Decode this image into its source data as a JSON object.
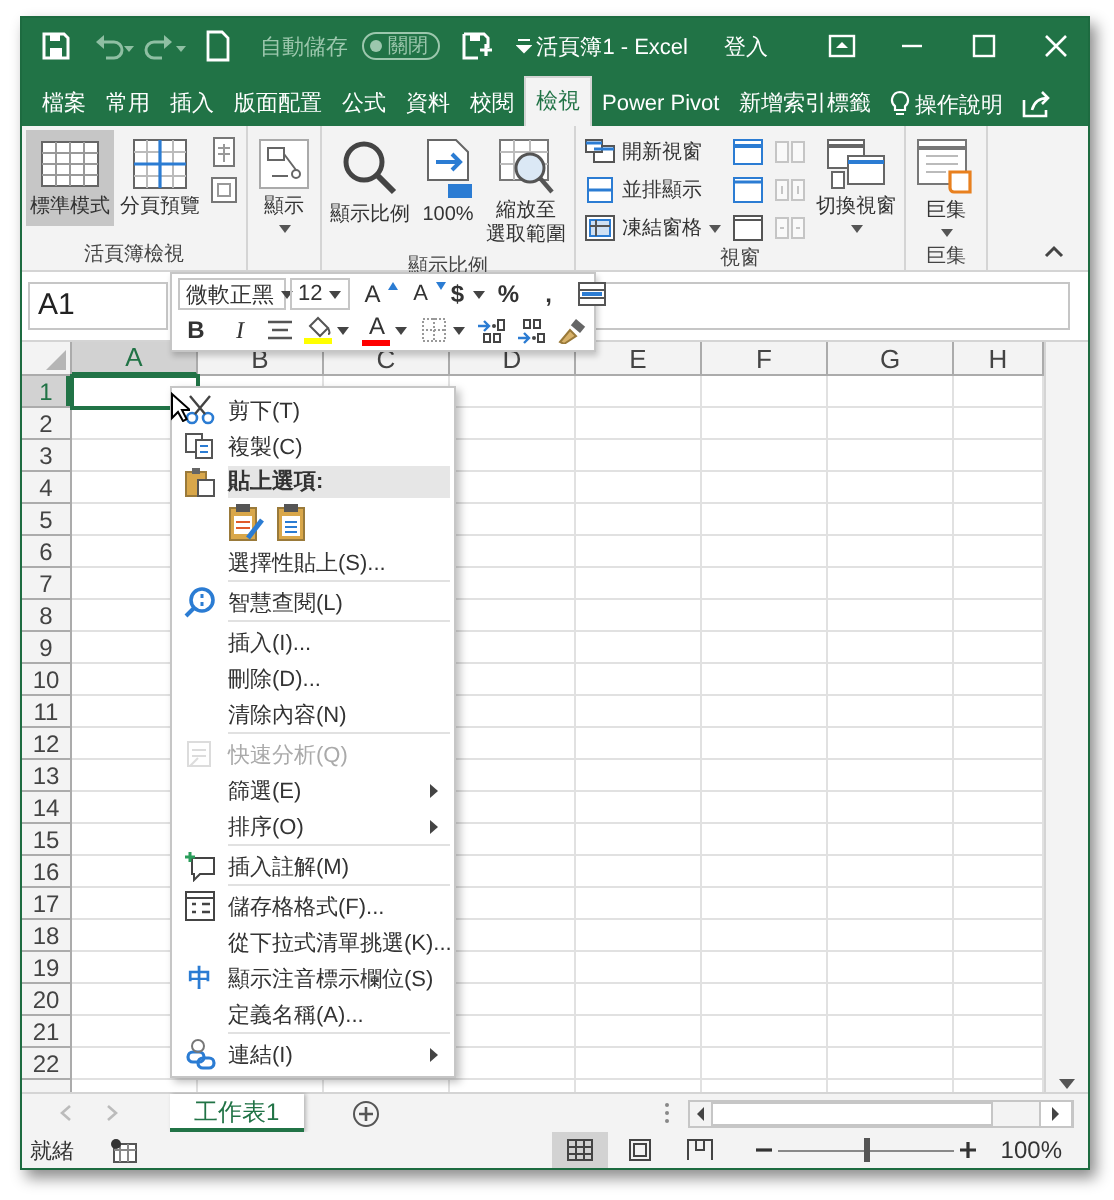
{
  "title_bar": {
    "autosave": {
      "label": "自動儲存",
      "state_text": "關閉",
      "on": false
    },
    "title": "活頁簿1 - Excel",
    "sign_in": "登入"
  },
  "tabs": [
    {
      "label": "檔案",
      "selected": false
    },
    {
      "label": "常用",
      "selected": false
    },
    {
      "label": "插入",
      "selected": false
    },
    {
      "label": "版面配置",
      "selected": false
    },
    {
      "label": "公式",
      "selected": false
    },
    {
      "label": "資料",
      "selected": false
    },
    {
      "label": "校閱",
      "selected": false
    },
    {
      "label": "檢視",
      "selected": true
    },
    {
      "label": "Power Pivot",
      "selected": false
    },
    {
      "label": "新增索引標籤",
      "selected": false
    }
  ],
  "tell_me": "操作說明",
  "ribbon": {
    "groups": [
      {
        "label": "活頁簿檢視",
        "columns": [
          {
            "kind": "large",
            "label": "標準模式",
            "selected": true,
            "dropdown": false
          },
          {
            "kind": "large",
            "label": "分頁預覽",
            "selected": false,
            "dropdown": false
          },
          {
            "kind": "stack",
            "items": [
              {
                "disabled": false
              },
              {
                "disabled": false
              }
            ]
          }
        ]
      },
      {
        "columns": [
          {
            "kind": "large",
            "label": "顯示",
            "selected": false,
            "dropdown": true
          }
        ]
      },
      {
        "label": "顯示比例",
        "columns": [
          {
            "kind": "large",
            "label": "顯示比例",
            "selected": false,
            "dropdown": false
          },
          {
            "kind": "large",
            "label": "100%",
            "selected": false,
            "dropdown": false
          },
          {
            "kind": "large",
            "lines": [
              "縮放至",
              "選取範圍"
            ],
            "selected": false,
            "dropdown": false
          }
        ]
      },
      {
        "label": "視窗",
        "columns": [
          {
            "kind": "stack",
            "items": [
              {
                "label": "開新視窗",
                "dropdown": false,
                "disabled": false
              },
              {
                "label": "並排顯示",
                "dropdown": false,
                "disabled": false
              },
              {
                "label": "凍結窗格",
                "dropdown": true,
                "disabled": false
              }
            ]
          },
          {
            "kind": "stack",
            "items": [
              {
                "disabled": false
              },
              {
                "disabled": false
              },
              {
                "disabled": false
              }
            ]
          },
          {
            "kind": "stack",
            "items": [
              {
                "disabled": true
              },
              {
                "disabled": true
              },
              {
                "disabled": true
              }
            ]
          },
          {
            "kind": "large",
            "label": "切換視窗",
            "selected": false,
            "dropdown": true
          }
        ]
      },
      {
        "label": "巨集",
        "columns": [
          {
            "kind": "large",
            "label": "巨集",
            "selected": false,
            "dropdown": true
          }
        ]
      }
    ]
  },
  "formula_bar": {
    "name_box": "A1"
  },
  "grid": {
    "columns": [
      {
        "label": "A",
        "selected": true
      },
      {
        "label": "B",
        "selected": false
      },
      {
        "label": "C",
        "selected": false
      },
      {
        "label": "D",
        "selected": false
      },
      {
        "label": "E",
        "selected": false
      },
      {
        "label": "F",
        "selected": false
      },
      {
        "label": "G",
        "selected": false
      },
      {
        "label": "H",
        "selected": false
      }
    ],
    "rows": [
      {
        "label": "1",
        "selected": true
      },
      {
        "label": "2",
        "selected": false
      },
      {
        "label": "3",
        "selected": false
      },
      {
        "label": "4",
        "selected": false
      },
      {
        "label": "5",
        "selected": false
      },
      {
        "label": "6",
        "selected": false
      },
      {
        "label": "7",
        "selected": false
      },
      {
        "label": "8",
        "selected": false
      },
      {
        "label": "9",
        "selected": false
      },
      {
        "label": "10",
        "selected": false
      },
      {
        "label": "11",
        "selected": false
      },
      {
        "label": "12",
        "selected": false
      },
      {
        "label": "13",
        "selected": false
      },
      {
        "label": "14",
        "selected": false
      },
      {
        "label": "15",
        "selected": false
      },
      {
        "label": "16",
        "selected": false
      },
      {
        "label": "17",
        "selected": false
      },
      {
        "label": "18",
        "selected": false
      },
      {
        "label": "19",
        "selected": false
      },
      {
        "label": "20",
        "selected": false
      },
      {
        "label": "21",
        "selected": false
      },
      {
        "label": "22",
        "selected": false
      }
    ]
  },
  "mini_toolbar": {
    "font": "微軟正黑",
    "size": "12",
    "row_1": [
      {
        "kind": "grow",
        "text": "A"
      },
      {
        "kind": "shrink",
        "text": "A"
      },
      {
        "kind": "currency",
        "text": "$"
      },
      {
        "kind": "percent",
        "text": "%"
      },
      {
        "kind": "comma",
        "text": ","
      },
      {
        "kind": "table_style"
      }
    ],
    "row_2": [
      {
        "kind": "bold",
        "text": "B"
      },
      {
        "kind": "italic",
        "text": "I"
      },
      {
        "kind": "center"
      },
      {
        "kind": "fill",
        "color": "#ffff00"
      },
      {
        "kind": "font_color",
        "text": "A",
        "color": "#ff0000"
      },
      {
        "kind": "borders"
      },
      {
        "kind": "increase_decimal"
      },
      {
        "kind": "decrease_decimal"
      },
      {
        "kind": "painter"
      }
    ]
  },
  "context_menu": [
    {
      "kind": "item",
      "label": "剪下(T)",
      "disabled": false
    },
    {
      "kind": "item",
      "label": "複製(C)",
      "disabled": false
    },
    {
      "kind": "header",
      "label": "貼上選項:"
    },
    {
      "kind": "paste_icons"
    },
    {
      "kind": "item",
      "label": "選擇性貼上(S)...",
      "disabled": false
    },
    {
      "kind": "separator"
    },
    {
      "kind": "item",
      "label": "智慧查閱(L)",
      "disabled": false
    },
    {
      "kind": "separator"
    },
    {
      "kind": "item",
      "label": "插入(I)...",
      "disabled": false
    },
    {
      "kind": "item",
      "label": "刪除(D)...",
      "disabled": false
    },
    {
      "kind": "item",
      "label": "清除內容(N)",
      "disabled": false
    },
    {
      "kind": "separator"
    },
    {
      "kind": "item",
      "label": "快速分析(Q)",
      "disabled": true
    },
    {
      "kind": "submenu",
      "label": "篩選(E)",
      "disabled": false
    },
    {
      "kind": "submenu",
      "label": "排序(O)",
      "disabled": false
    },
    {
      "kind": "separator"
    },
    {
      "kind": "item",
      "label": "插入註解(M)",
      "disabled": false
    },
    {
      "kind": "separator"
    },
    {
      "kind": "item",
      "label": "儲存格格式(F)...",
      "disabled": false
    },
    {
      "kind": "item",
      "label": "從下拉式清單挑選(K)...",
      "disabled": false
    },
    {
      "kind": "item",
      "label": "顯示注音標示欄位(S)",
      "disabled": false,
      "icon_text": "中"
    },
    {
      "kind": "item",
      "label": "定義名稱(A)...",
      "disabled": false
    },
    {
      "kind": "separator"
    },
    {
      "kind": "submenu",
      "label": "連結(I)",
      "disabled": false
    }
  ],
  "sheet_tabs": [
    {
      "label": "工作表1",
      "selected": true
    }
  ],
  "status_bar": {
    "text": "就緒",
    "views": [
      {
        "selected": true
      },
      {
        "selected": false
      },
      {
        "selected": false
      }
    ],
    "zoom": {
      "level": 0.5,
      "reading": "100%"
    }
  }
}
